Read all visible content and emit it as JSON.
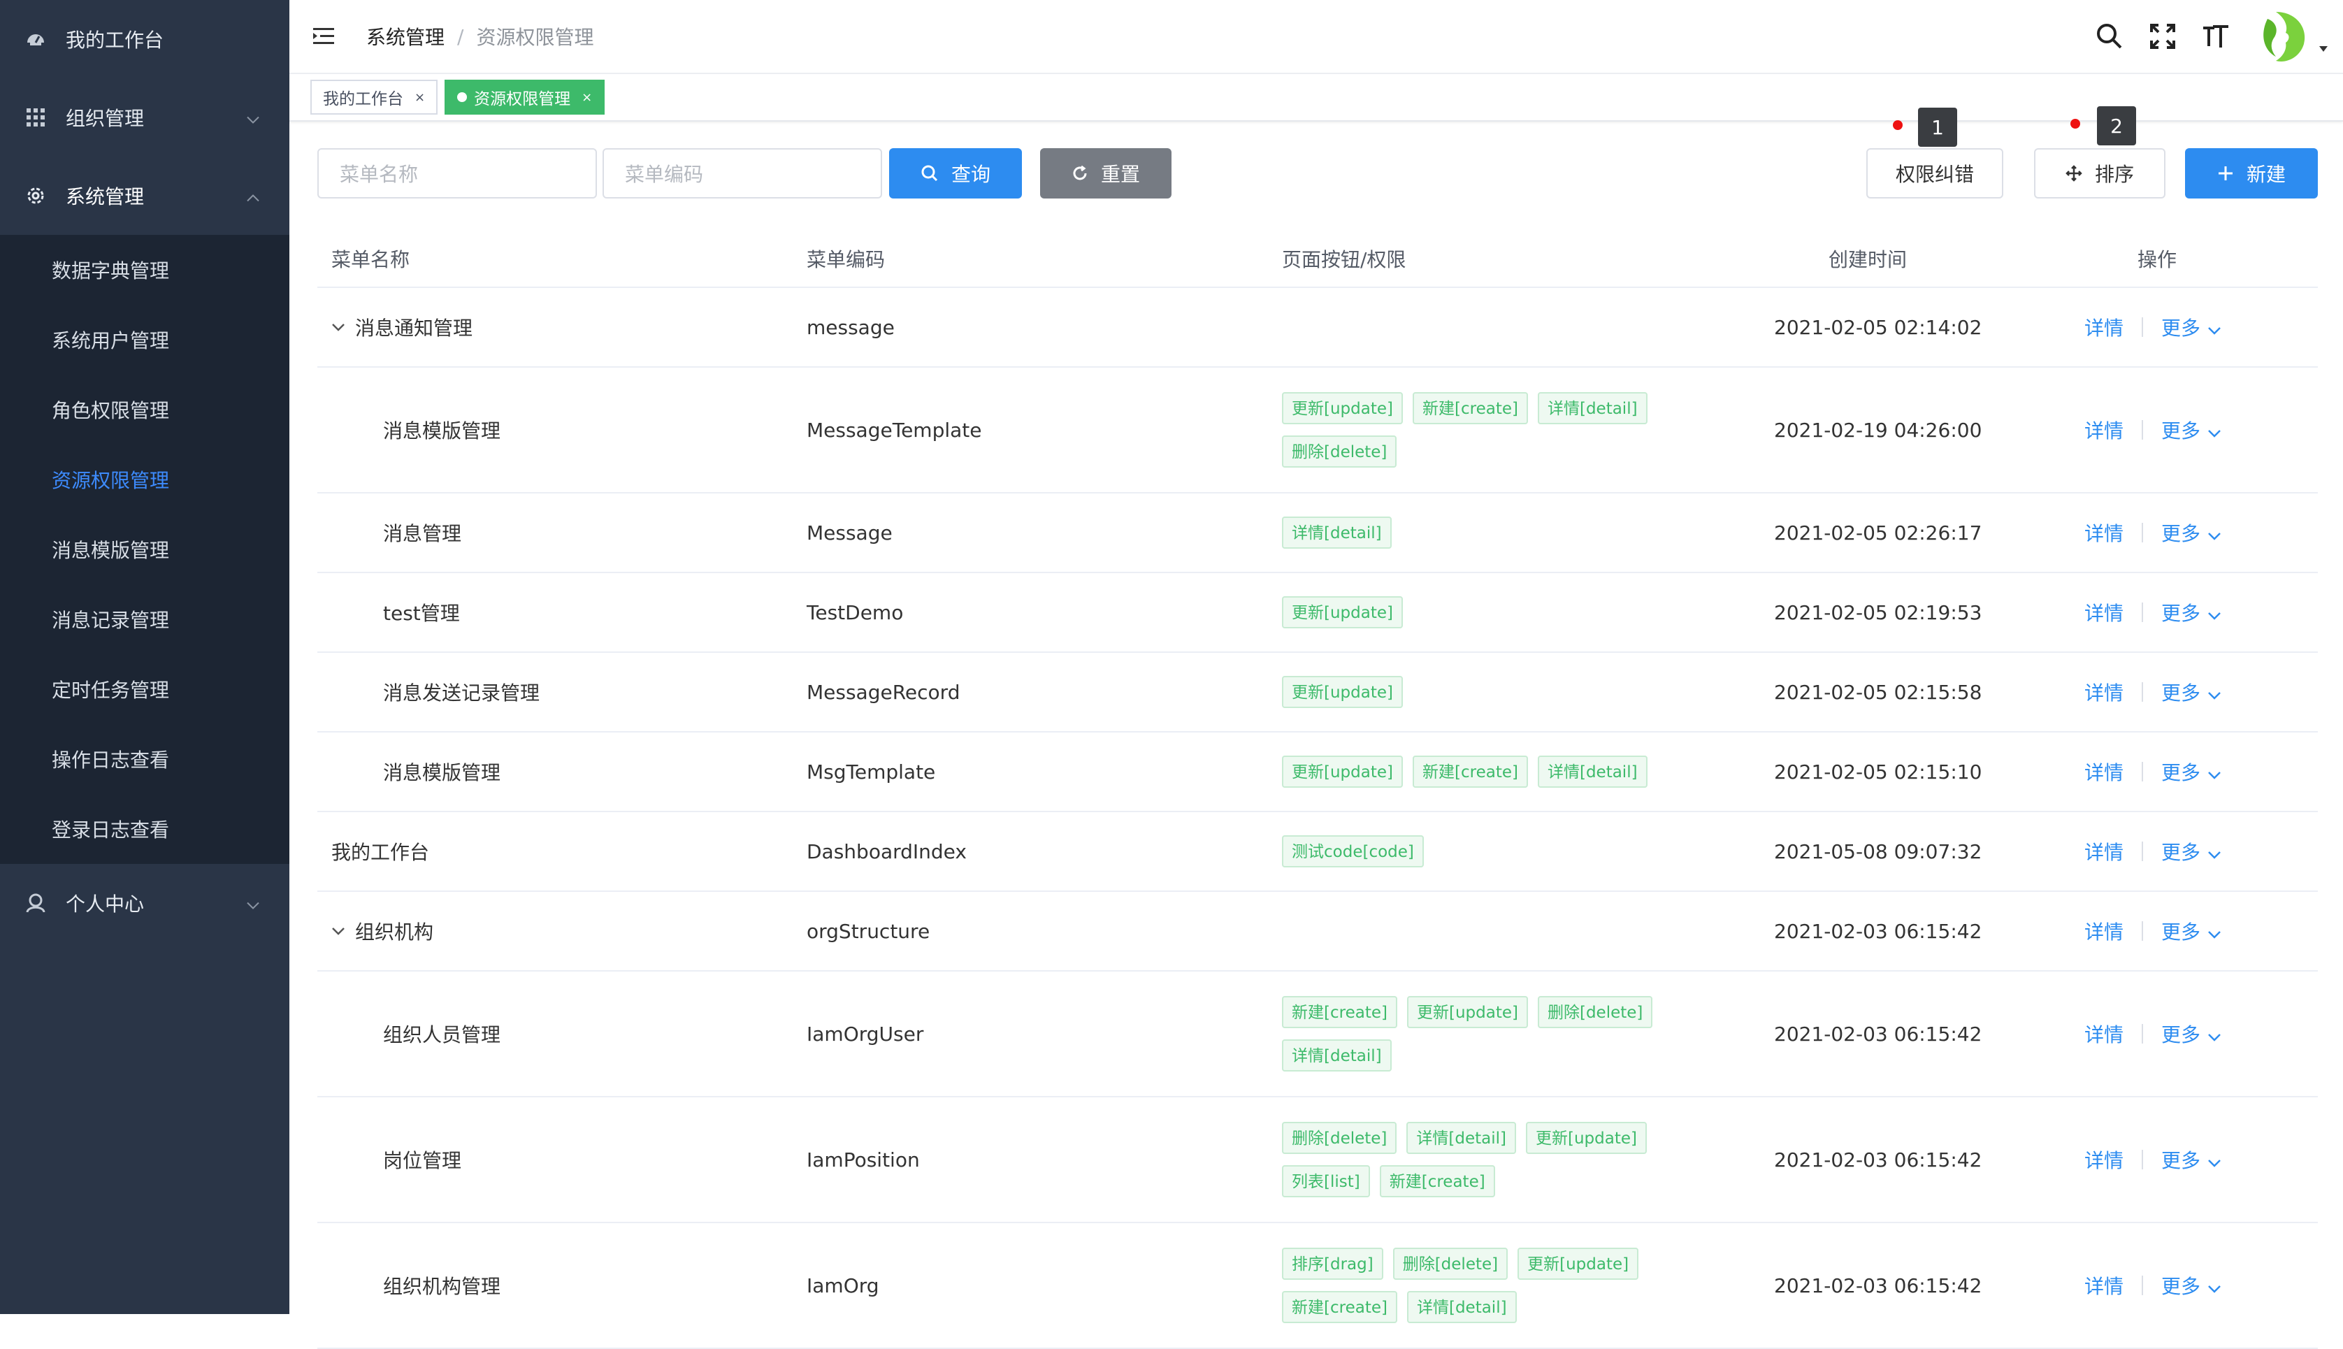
{
  "sidebar": {
    "workbench": "我的工作台",
    "org": "组织管理",
    "system": "系统管理",
    "sub_items": [
      {
        "label": "数据字典管理"
      },
      {
        "label": "系统用户管理"
      },
      {
        "label": "角色权限管理"
      },
      {
        "label": "资源权限管理"
      },
      {
        "label": "消息模版管理"
      },
      {
        "label": "消息记录管理"
      },
      {
        "label": "定时任务管理"
      },
      {
        "label": "操作日志查看"
      },
      {
        "label": "登录日志查看"
      }
    ],
    "active_index": 3,
    "personal": "个人中心"
  },
  "header": {
    "breadcrumb_parent": "系统管理",
    "breadcrumb_sep": "/",
    "breadcrumb_current": "资源权限管理",
    "icons": [
      "search-icon",
      "fullscreen-icon",
      "font-size-icon",
      "avatar"
    ]
  },
  "tags": {
    "workbench": "我的工作台",
    "current": "资源权限管理",
    "close": "×"
  },
  "filters": {
    "menu_name_placeholder": "菜单名称",
    "menu_code_placeholder": "菜单编码",
    "query": "查询",
    "reset": "重置",
    "fix_perm": "权限纠错",
    "sort": "排序",
    "create": "新建",
    "badge1": "1",
    "badge2": "2"
  },
  "table": {
    "columns": {
      "name": "菜单名称",
      "code": "菜单编码",
      "perm": "页面按钮/权限",
      "time": "创建时间",
      "op": "操作"
    },
    "op_detail": "详情",
    "op_more": "更多",
    "rows": [
      {
        "name": "消息通知管理",
        "code": "message",
        "time": "2021-02-05 02:14:02",
        "perms": [],
        "level": 0,
        "expand": true
      },
      {
        "name": "消息模版管理",
        "code": "MessageTemplate",
        "time": "2021-02-19 04:26:00",
        "perms": [
          "更新[update]",
          "新建[create]",
          "详情[detail]",
          "删除[delete]"
        ],
        "level": 1
      },
      {
        "name": "消息管理",
        "code": "Message",
        "time": "2021-02-05 02:26:17",
        "perms": [
          "详情[detail]"
        ],
        "level": 1
      },
      {
        "name": "test管理",
        "code": "TestDemo",
        "time": "2021-02-05 02:19:53",
        "perms": [
          "更新[update]"
        ],
        "level": 1
      },
      {
        "name": "消息发送记录管理",
        "code": "MessageRecord",
        "time": "2021-02-05 02:15:58",
        "perms": [
          "更新[update]"
        ],
        "level": 1
      },
      {
        "name": "消息模版管理",
        "code": "MsgTemplate",
        "time": "2021-02-05 02:15:10",
        "perms": [
          "更新[update]",
          "新建[create]",
          "详情[detail]"
        ],
        "level": 1
      },
      {
        "name": "我的工作台",
        "code": "DashboardIndex",
        "time": "2021-05-08 09:07:32",
        "perms": [
          "测试code[code]"
        ],
        "level": 0
      },
      {
        "name": "组织机构",
        "code": "orgStructure",
        "time": "2021-02-03 06:15:42",
        "perms": [],
        "level": 0,
        "expand": true
      },
      {
        "name": "组织人员管理",
        "code": "IamOrgUser",
        "time": "2021-02-03 06:15:42",
        "perms": [
          "新建[create]",
          "更新[update]",
          "删除[delete]",
          "详情[detail]"
        ],
        "level": 1
      },
      {
        "name": "岗位管理",
        "code": "IamPosition",
        "time": "2021-02-03 06:15:42",
        "perms": [
          "删除[delete]",
          "详情[detail]",
          "更新[update]",
          "列表[list]",
          "新建[create]"
        ],
        "level": 1
      },
      {
        "name": "组织机构管理",
        "code": "IamOrg",
        "time": "2021-02-03 06:15:42",
        "perms": [
          "排序[drag]",
          "删除[delete]",
          "更新[update]",
          "新建[create]",
          "详情[detail]"
        ],
        "level": 1
      }
    ]
  },
  "colors": {
    "sidebar_bg": "#2a3547",
    "submenu_bg": "#1c2533",
    "primary": "#2d8cf0",
    "success": "#3dba6a",
    "badge_dot": "#ee1111"
  }
}
